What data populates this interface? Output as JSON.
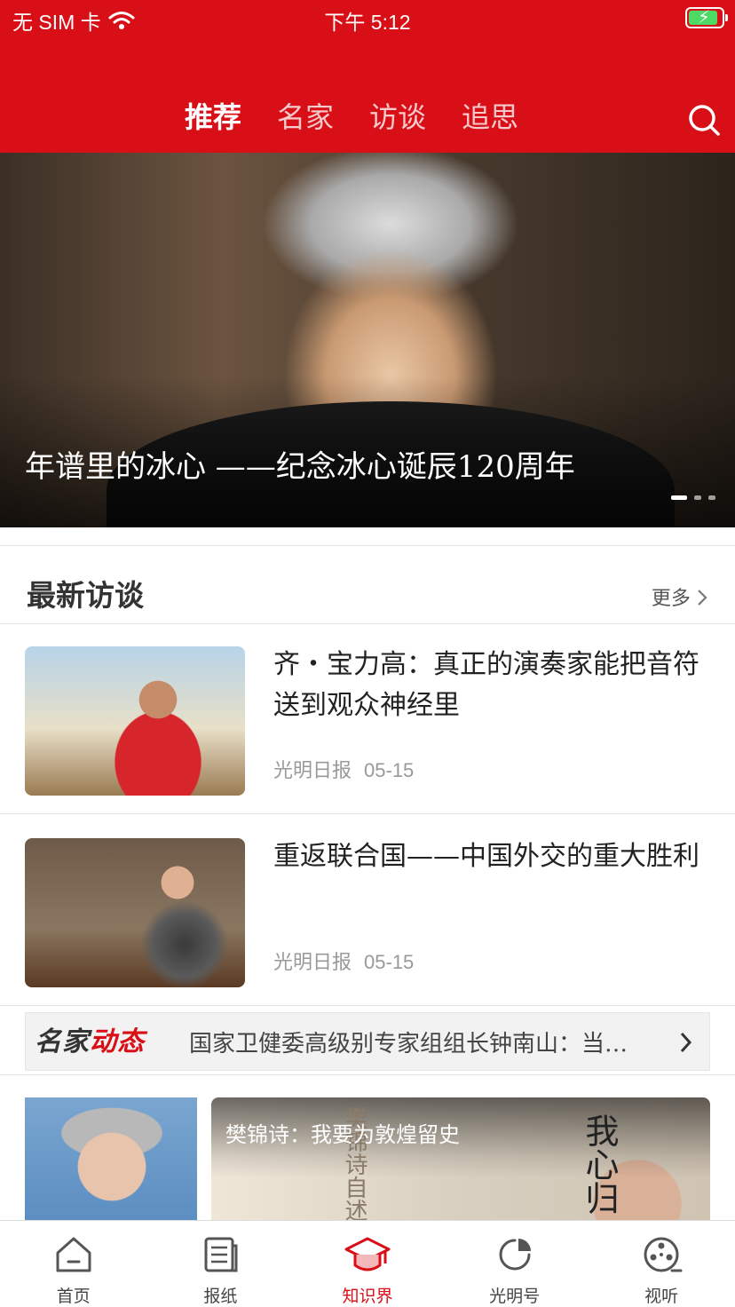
{
  "status_bar": {
    "carrier": "无 SIM 卡",
    "time": "下午 5:12",
    "battery_level": 0.9
  },
  "nav": {
    "tabs": [
      {
        "label": "推荐",
        "active": true
      },
      {
        "label": "名家",
        "active": false
      },
      {
        "label": "访谈",
        "active": false
      },
      {
        "label": "追思",
        "active": false
      }
    ],
    "search_icon": "search-icon"
  },
  "banner": {
    "title": "年谱里的冰心 ——纪念冰心诞辰120周年",
    "slide_count": 3,
    "active_slide": 1
  },
  "section": {
    "title": "最新访谈",
    "more_label": "更多"
  },
  "articles": [
    {
      "title": "齐・宝力高：真正的演奏家能把音符送到观众神经里",
      "source": "光明日报",
      "date": "05-15"
    },
    {
      "title": "重返联合国——中国外交的重大胜利",
      "source": "光明日报",
      "date": "05-15"
    }
  ],
  "ticker": {
    "logo_part1": "名家",
    "logo_part2": "动态",
    "text": "国家卫健委高级别专家组组长钟南山：当…"
  },
  "feature": {
    "caption": "樊锦诗：我要为敦煌留史",
    "book_text_left": "樊锦诗自述",
    "book_text_right": "我心归"
  },
  "tabbar": [
    {
      "label": "首页",
      "icon": "home-icon",
      "active": false
    },
    {
      "label": "报纸",
      "icon": "newspaper-icon",
      "active": false
    },
    {
      "label": "知识界",
      "icon": "graduation-cap-icon",
      "active": true
    },
    {
      "label": "光明号",
      "icon": "pie-chart-icon",
      "active": false
    },
    {
      "label": "视听",
      "icon": "film-reel-icon",
      "active": false
    }
  ],
  "colors": {
    "brand_red": "#d90f18",
    "tab_inactive": "#f6c9cb",
    "meta_gray": "#999999"
  }
}
